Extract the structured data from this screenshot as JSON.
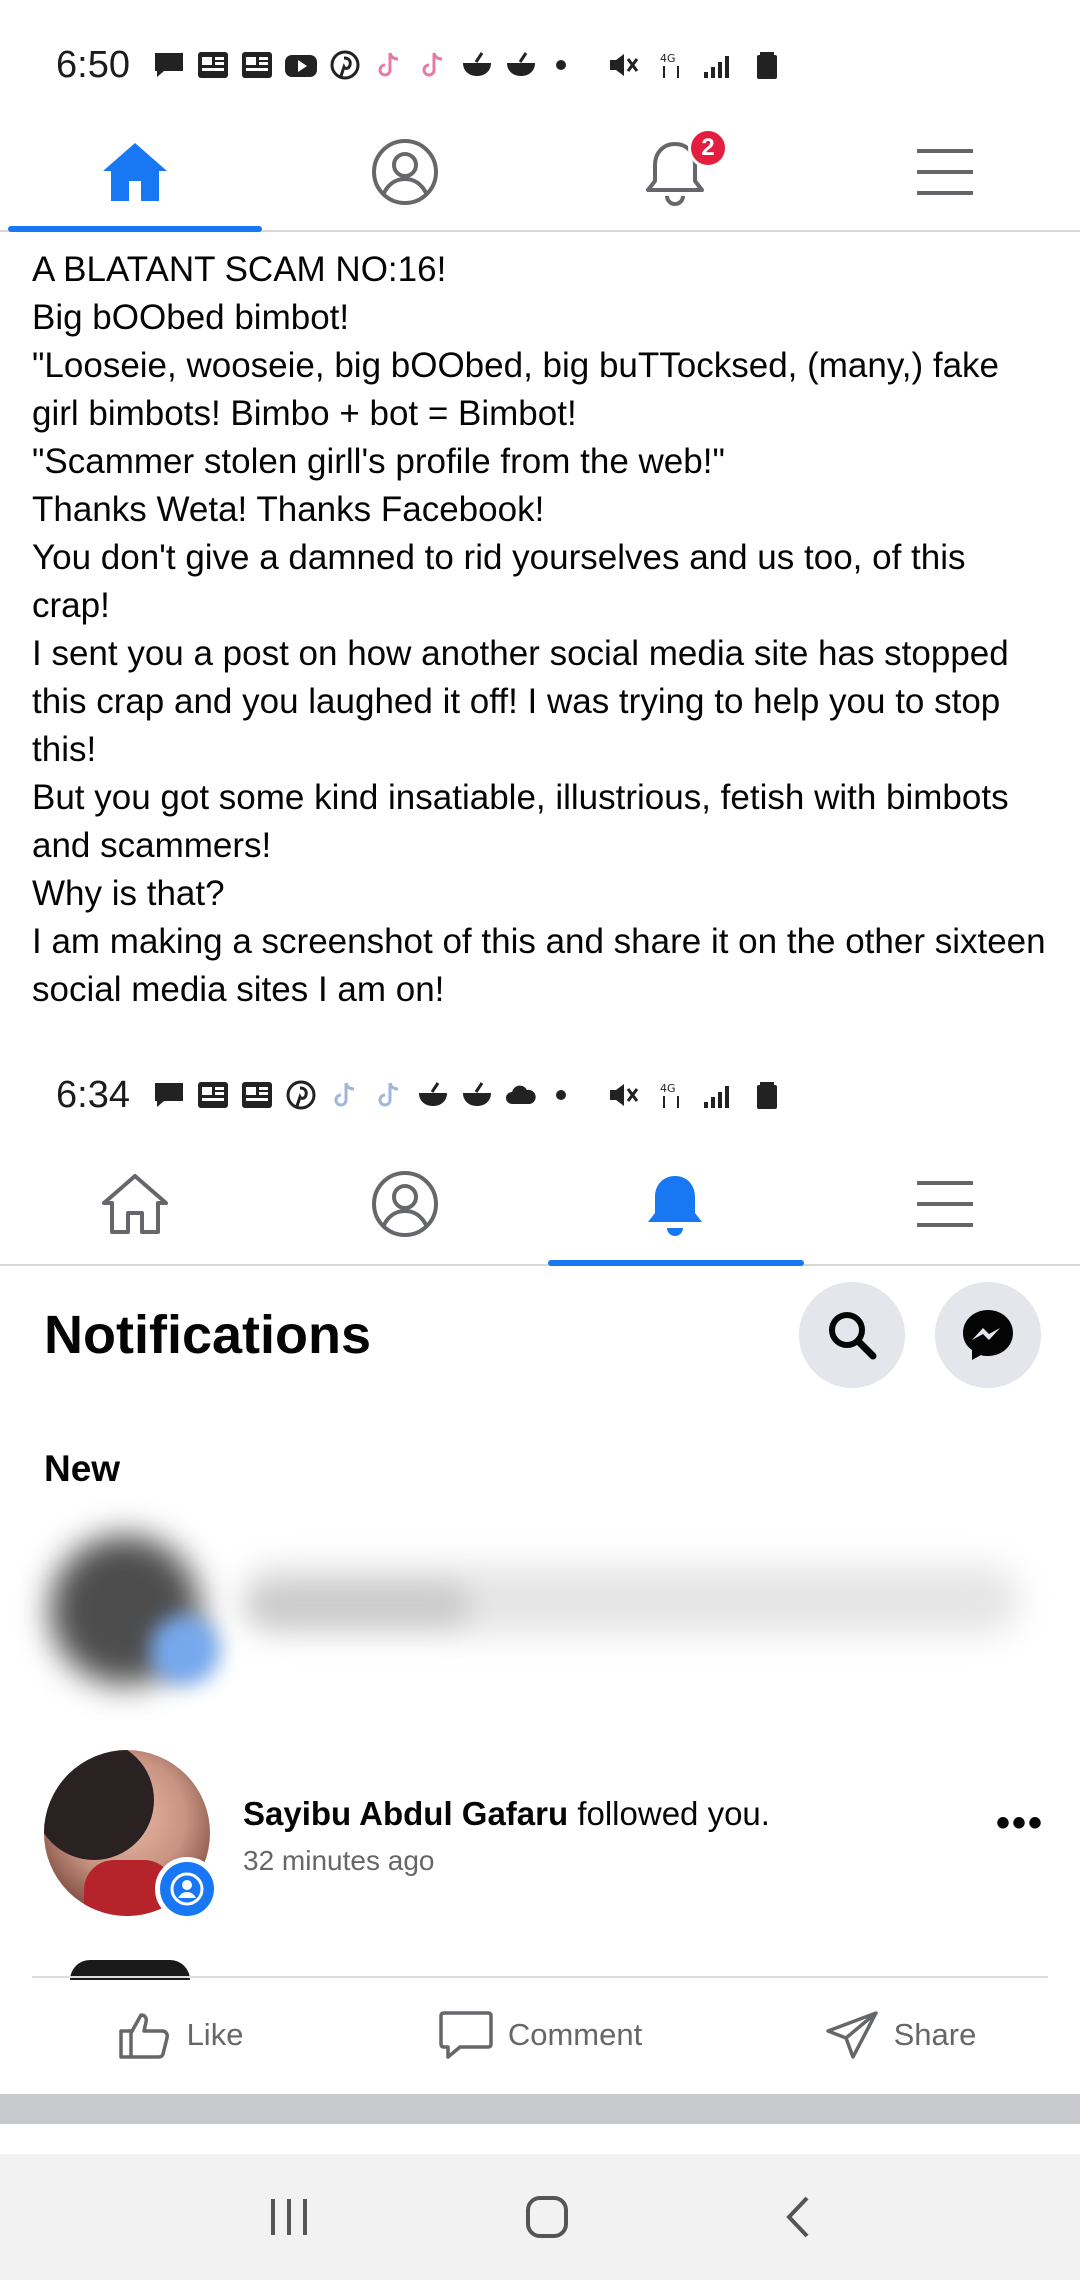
{
  "status_top": {
    "time": "6:50"
  },
  "nav_top": {
    "items": [
      "home",
      "profile",
      "notifications",
      "menu"
    ],
    "active": "home",
    "notification_badge": "2"
  },
  "post": {
    "lines": [
      "A BLATANT SCAM NO:16!",
      "Big bOObed bimbot!",
      "\"Looseie, wooseie, big bOObed, big buTTocksed, (many,) fake girl bimbots! Bimbo + bot = Bimbot!",
      "\"Scammer stolen girll's profile from the web!\"",
      "Thanks Weta! Thanks Facebook!",
      "You don't give a damned to rid yourselves and us too, of this crap!",
      "I sent you a post on how another social media site has stopped this crap and you laughed it off! I was trying to help you to stop this!",
      "But you got some kind insatiable, illustrious, fetish with bimbots and scammers!",
      "Why is that?",
      "I am making a screenshot of this and share it on the other sixteen social media sites I am on!"
    ]
  },
  "status_embedded": {
    "time": "6:34"
  },
  "nav_embedded": {
    "items": [
      "home",
      "profile",
      "notifications",
      "menu"
    ],
    "active": "notifications"
  },
  "notifications": {
    "title": "Notifications",
    "section_new": "New",
    "item": {
      "name": "Sayibu Abdul Gafaru",
      "action": " followed you.",
      "time": "32 minutes ago",
      "more": "•••"
    }
  },
  "actions": {
    "like": "Like",
    "comment": "Comment",
    "share": "Share"
  },
  "colors": {
    "accent": "#1877f2",
    "badge": "#e41e3f",
    "secondary_text": "#65676b"
  }
}
